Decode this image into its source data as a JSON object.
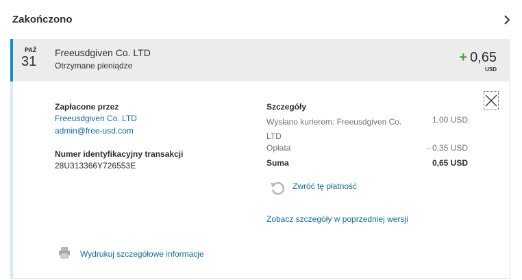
{
  "section": {
    "title": "Zakończono",
    "chevron_icon": "chevron-right-icon"
  },
  "transaction": {
    "month": "PAŹ",
    "day": "31",
    "merchant": "Freeusdgiven Co. LTD",
    "type": "Otrzymane pieniądze",
    "sign": "+",
    "amount": "0,65",
    "currency": "USD",
    "accent_color": "#0d8fd1",
    "positive_color": "#48a53e"
  },
  "details": {
    "paid_by_label": "Zapłacone przez",
    "paid_by_name": "Freeusdgiven Co. LTD",
    "paid_by_email": "admin@free-usd.com",
    "txn_id_label": "Numer identyfikacyjny transakcji",
    "txn_id_value": "28U313366Y726553E",
    "summary_title": "Szczegóły",
    "line_desc": "Wysłano kurierem: Freeusdgiven Co. LTD",
    "line_amount": "1,00 USD",
    "fee_label": "Opłata",
    "fee_amount": "- 0,35 USD",
    "total_label": "Suma",
    "total_amount": "0,65 USD",
    "refund_label": "Zwróć tę płatność",
    "refund_icon": "undo-icon",
    "prev_version_label": "Zobacz szczegóły w poprzedniej wersji",
    "print_label": "Wydrukuj szczegółowe informacje",
    "print_icon": "printer-icon",
    "close_icon": "close-icon"
  }
}
